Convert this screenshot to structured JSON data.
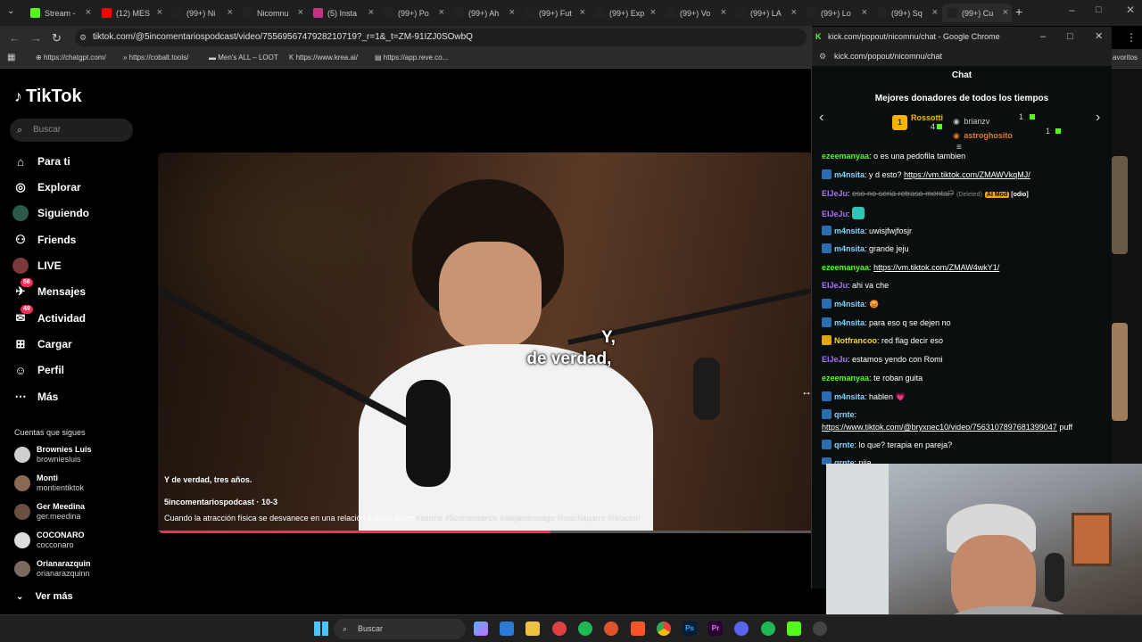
{
  "browser": {
    "tabs": [
      {
        "label": "Stream -",
        "color": "#53fc18",
        "icon": "kick-icon"
      },
      {
        "label": "(12) MES",
        "color": "#ff0000",
        "icon": "youtube-icon"
      },
      {
        "label": "(99+) Ni",
        "color": "#222222",
        "icon": "tiktok-icon"
      },
      {
        "label": "Nicomnu",
        "color": "#222222",
        "icon": "tiktok-icon"
      },
      {
        "label": "(5) Insta",
        "color": "#c13584",
        "icon": "instagram-icon"
      },
      {
        "label": "(99+) Po",
        "color": "#222222",
        "icon": "tiktok-icon"
      },
      {
        "label": "(99+) Ah",
        "color": "#222222",
        "icon": "tiktok-icon"
      },
      {
        "label": "(99+) Fut",
        "color": "#222222",
        "icon": "tiktok-icon"
      },
      {
        "label": "(99+) Exp",
        "color": "#222222",
        "icon": "tiktok-icon"
      },
      {
        "label": "(99+) Vo",
        "color": "#222222",
        "icon": "tiktok-icon"
      },
      {
        "label": "(99+) LA",
        "color": "#222222",
        "icon": "tiktok-icon"
      },
      {
        "label": "(99+) Lo",
        "color": "#222222",
        "icon": "tiktok-icon"
      },
      {
        "label": "(99+) Sq",
        "color": "#222222",
        "icon": "tiktok-icon"
      },
      {
        "label": "(99+) Cu",
        "color": "#222222",
        "icon": "tiktok-icon"
      }
    ],
    "url": "tiktok.com/@5incomentariospodcast/video/7556956747928210719?_r=1&_t=ZM-91IZJ0SOwbQ",
    "bookmarks": [
      "https://chatgpt.com/",
      "https://cobalt.tools/",
      "Men's ALL – LOOT",
      "https://www.krea.ai/",
      "https://app.reve.co..."
    ],
    "bookmarks_right": "avoritos"
  },
  "tiktok": {
    "logo": "TikTok",
    "search_placeholder": "Buscar",
    "nav": [
      {
        "label": "Para ti",
        "icon": "home-icon"
      },
      {
        "label": "Explorar",
        "icon": "compass-icon"
      },
      {
        "label": "Siguiendo",
        "icon": "following-icon"
      },
      {
        "label": "Friends",
        "icon": "friends-icon"
      },
      {
        "label": "LIVE",
        "icon": "live-icon"
      },
      {
        "label": "Mensajes",
        "icon": "messages-icon",
        "badge": "56"
      },
      {
        "label": "Actividad",
        "icon": "activity-icon",
        "badge": "49"
      },
      {
        "label": "Cargar",
        "icon": "upload-icon"
      },
      {
        "label": "Perfil",
        "icon": "profile-icon"
      },
      {
        "label": "Más",
        "icon": "more-icon"
      }
    ],
    "following_title": "Cuentas que sigues",
    "following": [
      {
        "name": "Brownies Luis",
        "handle": "browniesluis"
      },
      {
        "name": "Monti",
        "handle": "montientiktok"
      },
      {
        "name": "Ger Meedina",
        "handle": "ger.meedina"
      },
      {
        "name": "COCONARO",
        "handle": "cocconaro"
      },
      {
        "name": "Orianarazquin",
        "handle": "orianarazquinn"
      }
    ],
    "see_more": "Ver más"
  },
  "video": {
    "caption_line1": "Y,",
    "caption_line2": "de verdad,",
    "subtitle": "Y de verdad, tres años.",
    "author": "5incomentariospodcast · 10-3",
    "description": "Cuando la atracción física se desvanece en una relación a largo plazo",
    "hashtags": "#zerme  #5comentarios  #alejandrosago  #luischaparro  #relacion",
    "progress": 0.6
  },
  "chat": {
    "window_title": "kick.com/popout/nicomnu/chat - Google Chrome",
    "url": "kick.com/popout/nicomnu/chat",
    "header": "Chat",
    "donors_title": "Mejores donadores de todos los tiempos",
    "donors": [
      {
        "name": "Rossotti",
        "amount": "4",
        "rank": "1"
      },
      {
        "name": "brianzv",
        "amount": "1"
      },
      {
        "name": "astroghosito",
        "amount": "1"
      }
    ],
    "messages": [
      {
        "user": "ezeemanyaa",
        "color": "#53fc18",
        "text": "o es una pedofila tambien",
        "badge": false
      },
      {
        "user": "m4nsita",
        "color": "#7fd4ff",
        "text": "y d esto?",
        "link": "https://vm.tiktok.com/ZMAWVkqMJ/",
        "badge": true
      },
      {
        "user": "ElJeJu",
        "color": "#a970ff",
        "deleted": "eso no seria retraso mental?",
        "deleted_tag": "(Deleted)",
        "mod": "AI Mod",
        "extra": "[odio]"
      },
      {
        "user": "ElJeJu",
        "color": "#a970ff",
        "text": "",
        "emote": "emote-icon"
      },
      {
        "user": "m4nsita",
        "color": "#7fd4ff",
        "text": "uwisjfwjfosjr",
        "badge": true
      },
      {
        "user": "m4nsita",
        "color": "#7fd4ff",
        "text": "grande jeju",
        "badge": true
      },
      {
        "user": "ezeemanyaa",
        "color": "#53fc18",
        "text": "",
        "link": "https://vm.tiktok.com/ZMAW4wkY1/"
      },
      {
        "user": "ElJeJu",
        "color": "#a970ff",
        "text": "ahi va che"
      },
      {
        "user": "m4nsita",
        "color": "#7fd4ff",
        "text": "😡",
        "badge": true
      },
      {
        "user": "m4nsita",
        "color": "#7fd4ff",
        "text": "para eso q se dejen no",
        "badge": true
      },
      {
        "user": "Notfrancoo",
        "color": "#f4d03f",
        "text": "red flag decir eso",
        "badge": true,
        "badge_color": "yellow"
      },
      {
        "user": "ElJeJu",
        "color": "#a970ff",
        "text": "estamos yendo con Romi"
      },
      {
        "user": "ezeemanyaa",
        "color": "#53fc18",
        "text": "te roban guita"
      },
      {
        "user": "m4nsita",
        "color": "#7fd4ff",
        "text": "hablen 💗",
        "badge": true
      },
      {
        "user": "qrnte",
        "color": "#7fd4ff",
        "text": "",
        "badge": true
      },
      {
        "user": "",
        "color": "#ffffff",
        "link": "https://www.tiktok.com/@bryxnec10/video/7563107897681399047",
        "text": "puff"
      },
      {
        "user": "qrnte",
        "color": "#7fd4ff",
        "text": "lo que? terapia en pareja?",
        "badge": true
      },
      {
        "user": "qrnte",
        "color": "#7fd4ff",
        "text": "nija",
        "badge": true
      }
    ]
  },
  "taskbar": {
    "search_placeholder": "Buscar"
  }
}
